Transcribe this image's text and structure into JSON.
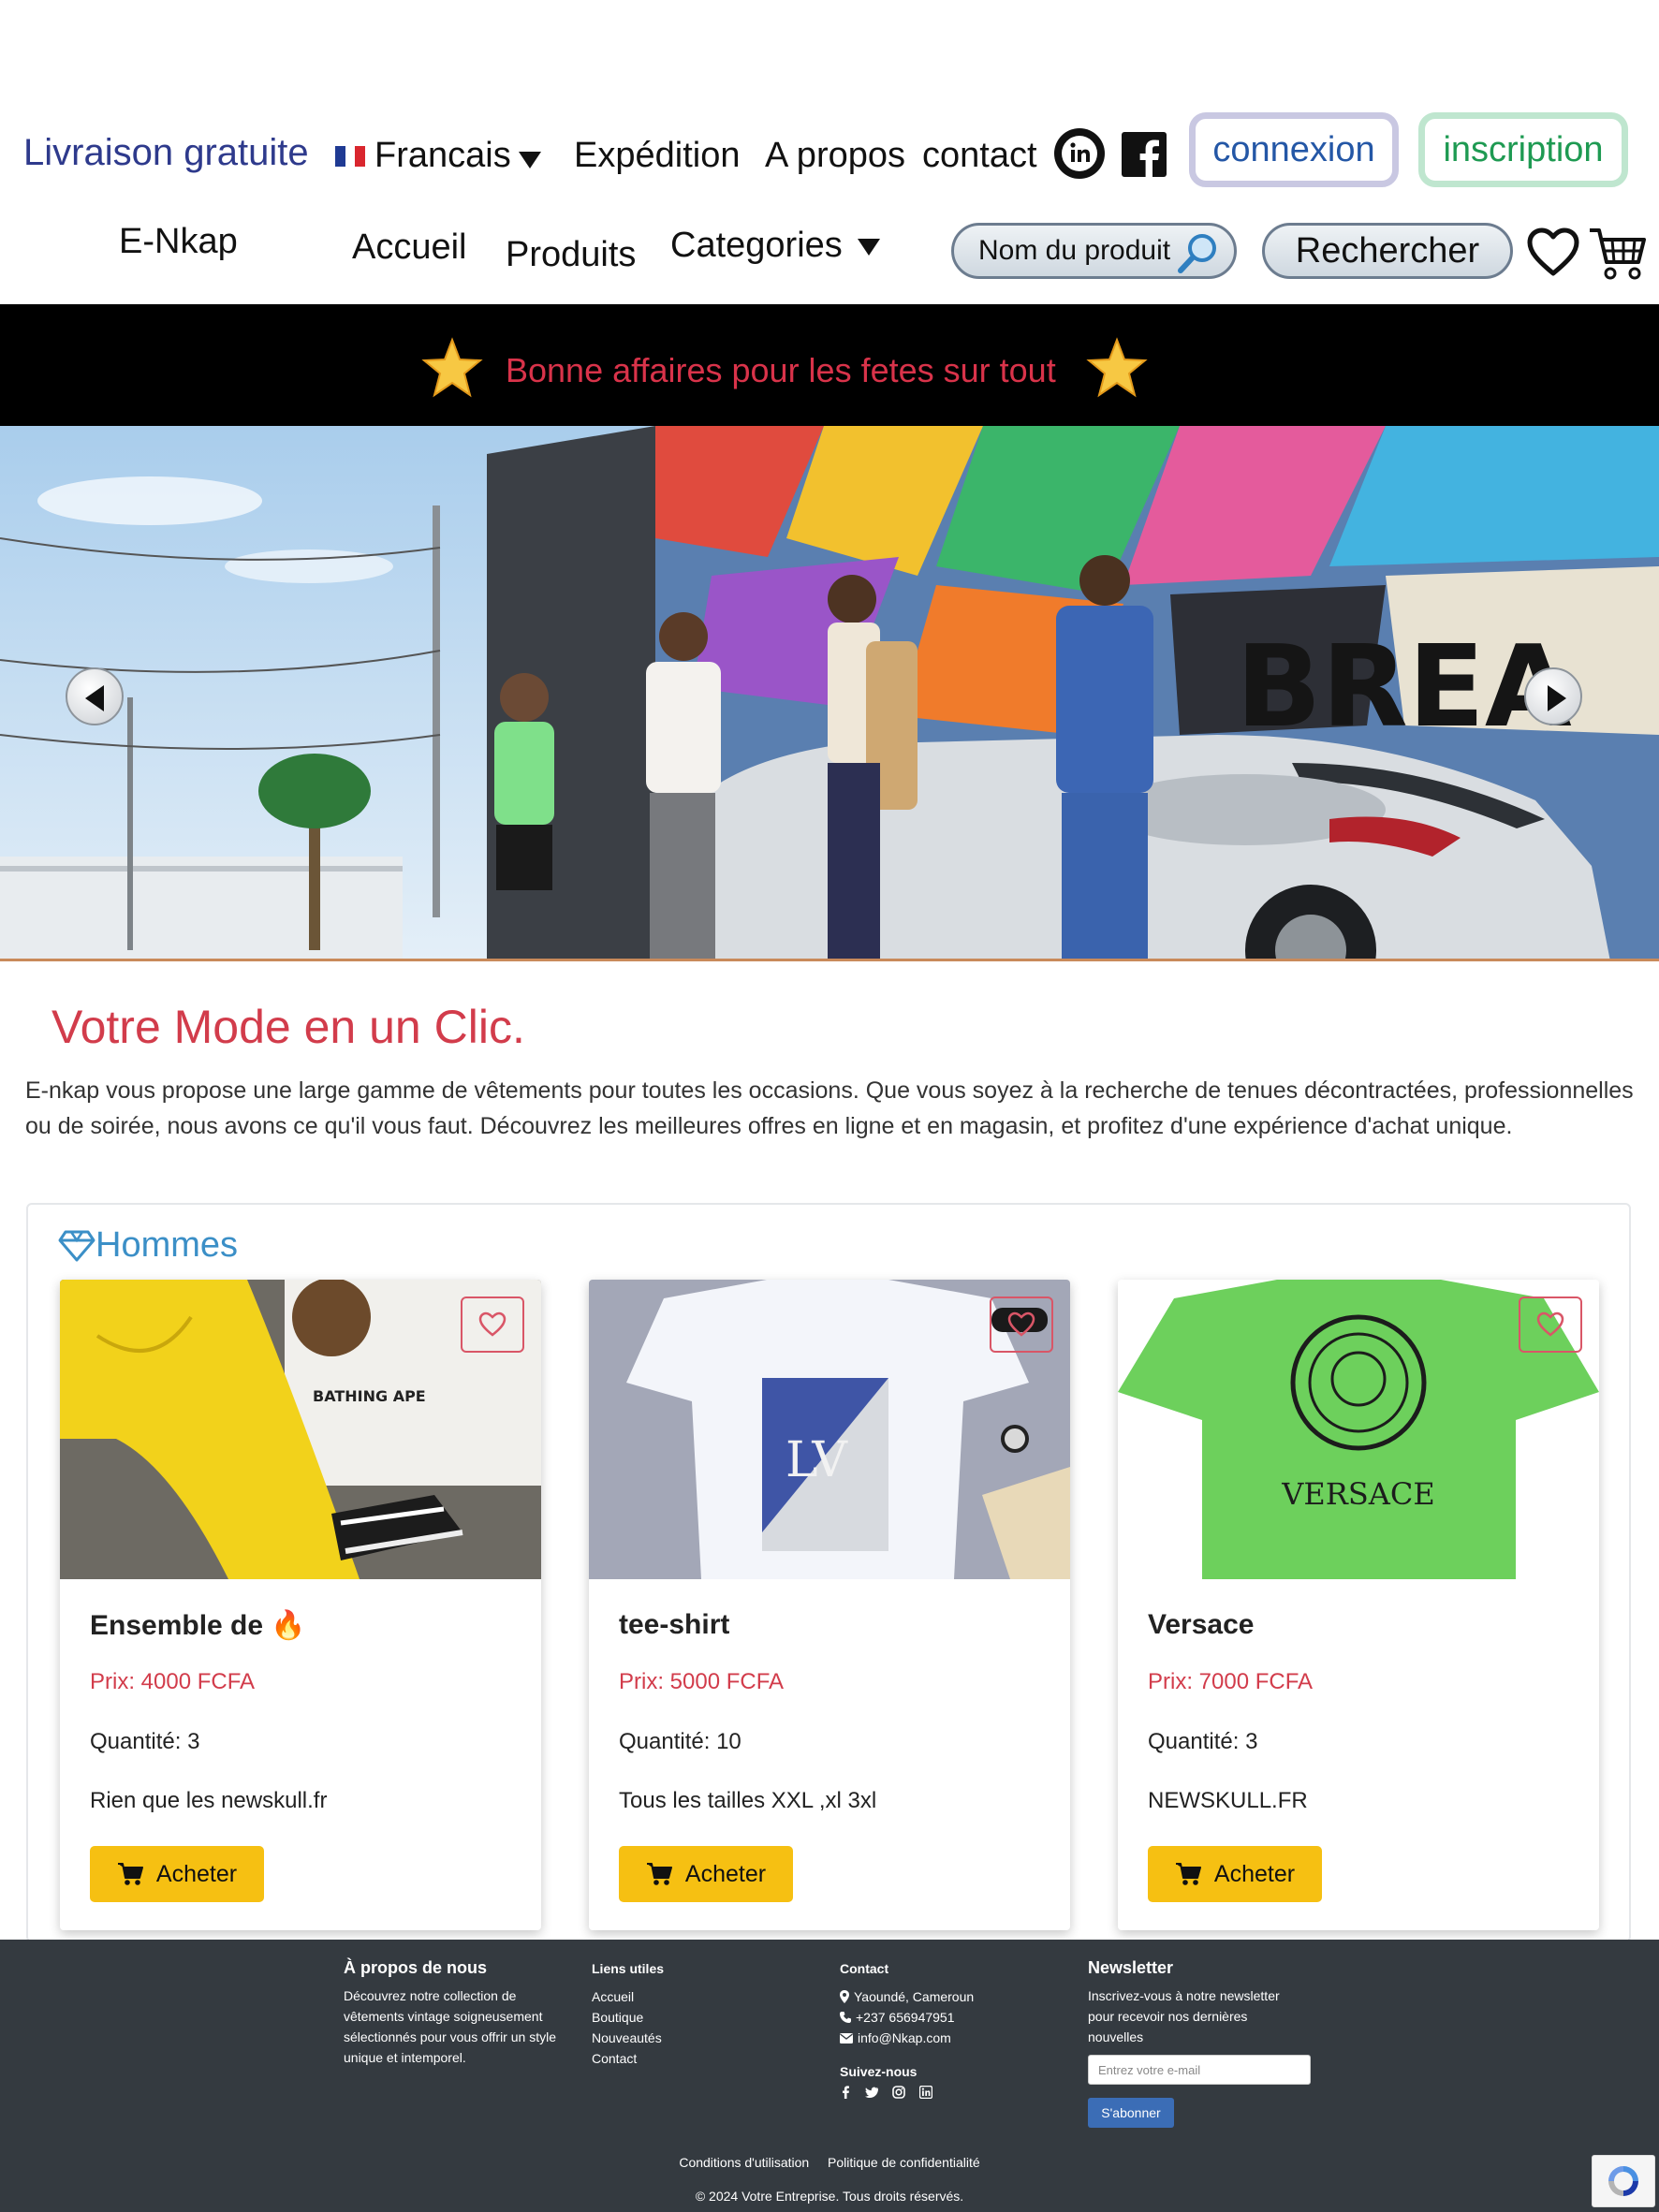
{
  "topbar": {
    "free_shipping": "Livraison gratuite",
    "language": "Francais",
    "links": [
      "Expédition",
      "A propos",
      "contact"
    ],
    "login_label": "connexion",
    "signup_label": "inscription"
  },
  "nav": {
    "brand": "E-Nkap",
    "links": [
      "Accueil",
      "Produits",
      "Categories"
    ],
    "search_placeholder": "Nom du produit",
    "search_button": "Rechercher"
  },
  "promo": {
    "text": "Bonne affaires pour les fetes sur tout"
  },
  "intro": {
    "headline": "Votre Mode en un Clic.",
    "text": "E-nkap vous propose une large gamme de vêtements pour toutes les occasions. Que vous soyez à la recherche de tenues décontractées, professionnelles ou de soirée, nous avons ce qu'il vous faut. Découvrez les meilleures offres en ligne et en magasin, et profitez d'une expérience d'achat unique."
  },
  "products": {
    "section_title": "Hommes",
    "items": [
      {
        "name": "Ensemble de 🔥",
        "price": "Prix: 4000 FCFA",
        "quantity": "Quantité: 3",
        "description": "Rien que les newskull.fr",
        "button": "Acheter"
      },
      {
        "name": "tee-shirt",
        "price": "Prix: 5000 FCFA",
        "quantity": "Quantité: 10",
        "description": "Tous les tailles XXL ,xl 3xl",
        "button": "Acheter"
      },
      {
        "name": "Versace",
        "price": "Prix: 7000 FCFA",
        "quantity": "Quantité: 3",
        "description": "NEWSKULL.FR",
        "button": "Acheter"
      }
    ]
  },
  "footer": {
    "about_title": "À propos de nous",
    "about_text": "Découvrez notre collection de vêtements vintage soigneusement sélectionnés pour vous offrir un style unique et intemporel.",
    "links_title": "Liens utiles",
    "links": [
      "Accueil",
      "Boutique",
      "Nouveautés",
      "Contact"
    ],
    "contact_title": "Contact",
    "address": "Yaoundé, Cameroun",
    "phone": "+237 656947951",
    "email": "info@Nkap.com",
    "follow_title": "Suivez-nous",
    "newsletter_title": "Newsletter",
    "newsletter_text": "Inscrivez-vous à notre newsletter pour recevoir nos dernières nouvelles",
    "newsletter_placeholder": "Entrez votre e-mail",
    "subscribe_label": "S'abonner",
    "terms": "Conditions d'utilisation",
    "privacy": "Politique de confidentialité",
    "copyright": "© 2024 Votre Entreprise. Tous droits réservés."
  },
  "icons": {
    "flag": "french-flag",
    "social": [
      "linkedin-icon",
      "facebook-icon"
    ],
    "nav": [
      "search-icon",
      "heart-icon",
      "cart-icon"
    ],
    "promo": "star-icon"
  },
  "colors": {
    "brand_blue": "#2e3a8c",
    "accent_red": "#d23c4b",
    "buy_yellow": "#f6c012",
    "footer_bg": "#343a40",
    "section_title": "#3b8fc7"
  }
}
